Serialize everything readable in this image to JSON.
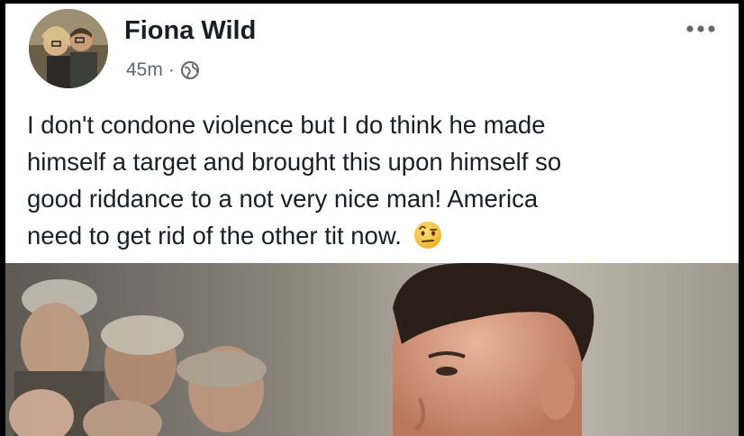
{
  "post": {
    "author": "Fiona Wild",
    "time": "45m",
    "separator": "·",
    "privacy_icon": "globe-icon",
    "more_icon": "more-options-icon",
    "text_lines": [
      "I don't condone violence but I do think he made",
      "himself a target and brought this upon himself so",
      "good riddance to a not very nice man! America",
      "need to get rid of the other tit now."
    ],
    "emoji_icon": "raised-eyebrow-emoji-icon"
  },
  "photo": {
    "description_icon": "post-photo"
  },
  "colors": {
    "name": "#1c1e21",
    "meta": "#65676b",
    "background": "#ffffff"
  }
}
